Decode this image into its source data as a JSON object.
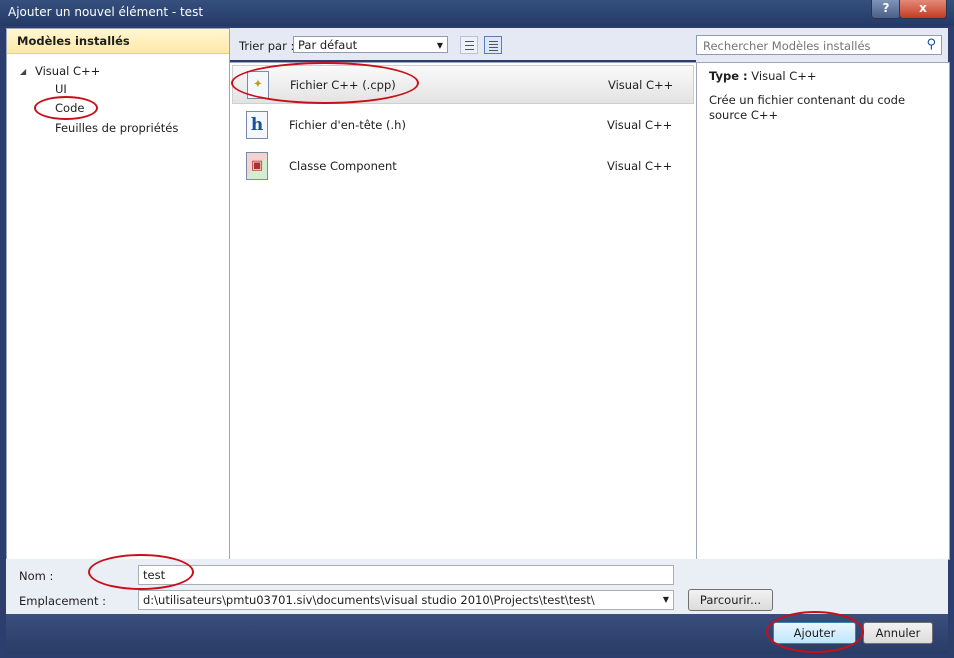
{
  "window": {
    "title": "Ajouter un nouvel élément - test",
    "help_label": "?",
    "close_label": "x"
  },
  "left_pane": {
    "header": "Modèles installés",
    "tree": [
      {
        "label": "Visual C++",
        "expanded": true
      },
      {
        "label": "UI"
      },
      {
        "label": "Code",
        "selected": true
      },
      {
        "label": "Feuilles de propriétés"
      }
    ]
  },
  "toolbar": {
    "sort_label": "Trier par :",
    "sort_value": "Par défaut",
    "view_modes": [
      "small-icons",
      "list-details"
    ],
    "active_view": "list-details"
  },
  "templates": [
    {
      "name": "Fichier C++ (.cpp)",
      "language": "Visual C++",
      "icon": "cpp-file-icon",
      "selected": true
    },
    {
      "name": "Fichier d'en-tête (.h)",
      "language": "Visual C++",
      "icon": "header-file-icon"
    },
    {
      "name": "Classe Component",
      "language": "Visual C++",
      "icon": "component-class-icon"
    }
  ],
  "search": {
    "placeholder": "Rechercher Modèles installés",
    "icon": "search-icon"
  },
  "description": {
    "type_label": "Type :",
    "type_value": "Visual C++",
    "text": "Crée un fichier contenant du code source C++"
  },
  "form": {
    "name_label": "Nom :",
    "name_value": "test",
    "location_label": "Emplacement :",
    "location_value": "d:\\utilisateurs\\pmtu03701.siv\\documents\\visual studio 2010\\Projects\\test\\test\\",
    "browse_label": "Parcourir..."
  },
  "buttons": {
    "add_label": "Ajouter",
    "cancel_label": "Annuler"
  },
  "colors": {
    "annotation": "#c8101a",
    "header_gold": "#fde9a5",
    "frame_blue": "#2b3e6e"
  }
}
